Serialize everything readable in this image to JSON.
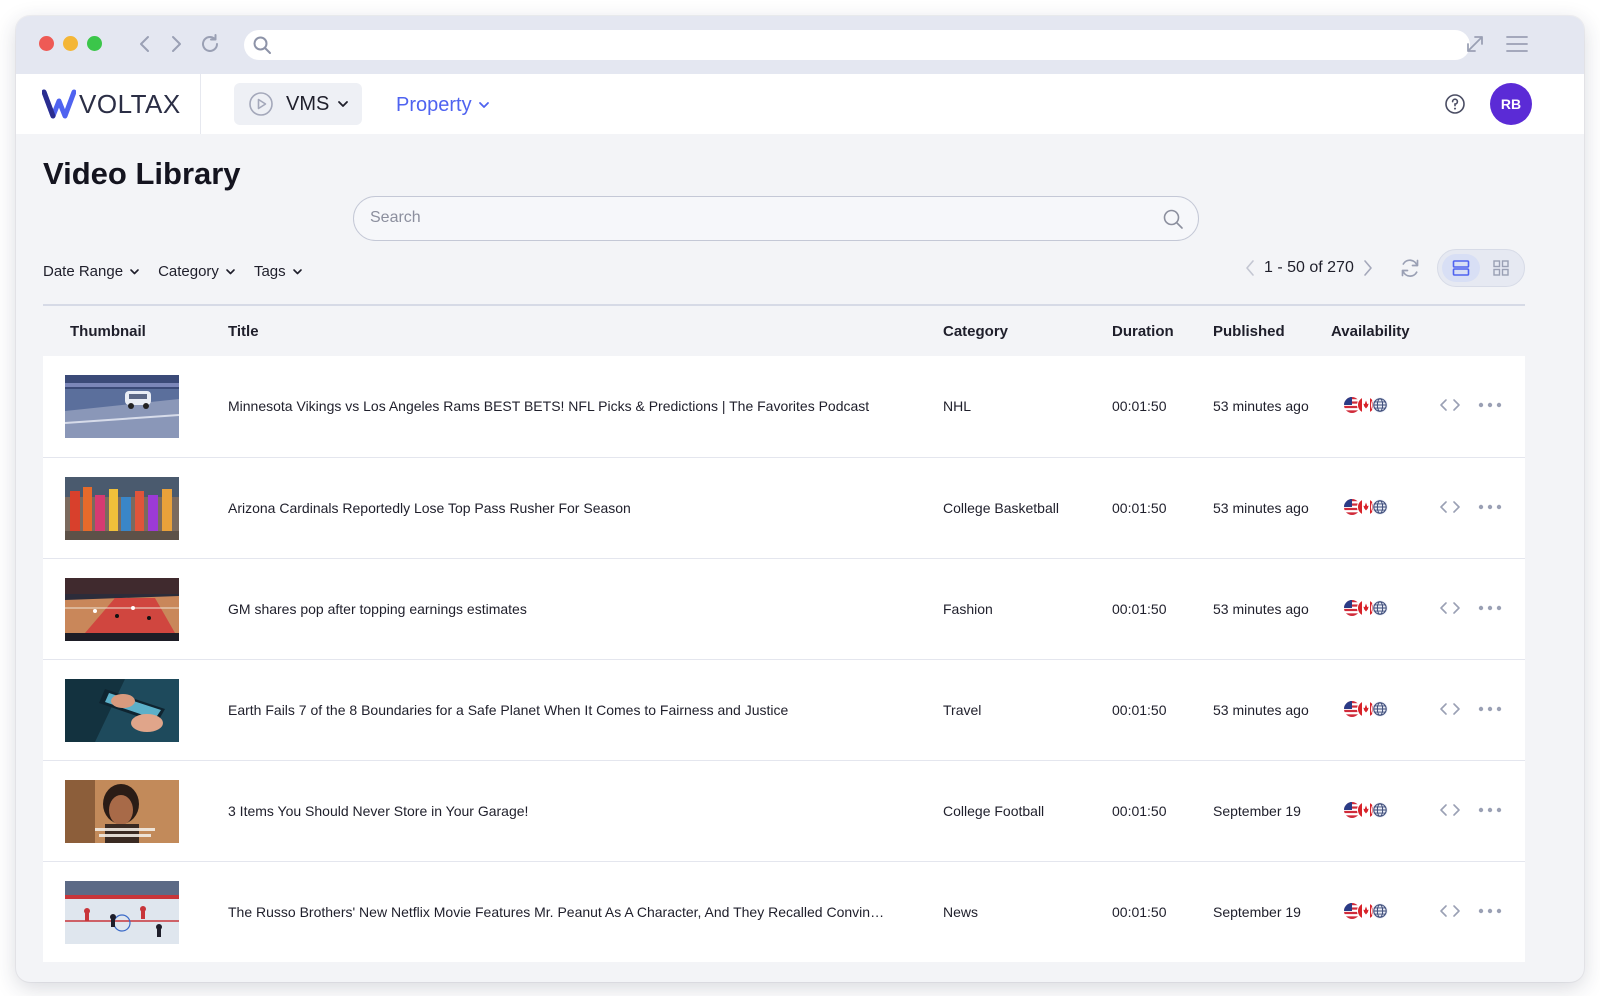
{
  "browser": {
    "url": ""
  },
  "header": {
    "logo_text": "VOLTAX",
    "product_label": "VMS",
    "property_label": "Property",
    "avatar_initials": "RB",
    "brand_color": "#4f63f0",
    "avatar_color": "#5b2bd6"
  },
  "page": {
    "title": "Video Library"
  },
  "search": {
    "placeholder": "Search",
    "value": ""
  },
  "filters": [
    {
      "label": "Date Range"
    },
    {
      "label": "Category"
    },
    {
      "label": "Tags"
    }
  ],
  "pagination": {
    "text": "1 - 50 of 270"
  },
  "view": {
    "selected": "list"
  },
  "table": {
    "columns": {
      "thumbnail": "Thumbnail",
      "title": "Title",
      "category": "Category",
      "duration": "Duration",
      "published": "Published",
      "availability": "Availability"
    },
    "rows": [
      {
        "thumbnail": "road-car",
        "title": "Minnesota Vikings vs Los Angeles Rams BEST BETS! NFL Picks & Predictions | The Favorites Podcast",
        "category": "NHL",
        "duration": "00:01:50",
        "published": "53 minutes ago"
      },
      {
        "thumbnail": "crowd-parade",
        "title": "Arizona Cardinals Reportedly Lose Top Pass Rusher For Season",
        "category": "College Basketball",
        "duration": "00:01:50",
        "published": "53 minutes ago"
      },
      {
        "thumbnail": "basketball-court",
        "title": "GM shares pop after topping earnings estimates",
        "category": "Fashion",
        "duration": "00:01:50",
        "published": "53 minutes ago"
      },
      {
        "thumbnail": "hands-phone",
        "title": "Earth Fails 7 of the 8 Boundaries for a Safe Planet When It Comes to Fairness and Justice",
        "category": "Travel",
        "duration": "00:01:50",
        "published": "53 minutes ago"
      },
      {
        "thumbnail": "woman-portrait",
        "title": "3 Items You Should Never Store in Your Garage!",
        "category": "College Football",
        "duration": "00:01:50",
        "published": "September 19"
      },
      {
        "thumbnail": "hockey-rink",
        "title": "The Russo Brothers' New Netflix Movie Features Mr. Peanut As A Character, And They Recalled Convinc...",
        "category": "News",
        "duration": "00:01:50",
        "published": "September 19"
      }
    ]
  },
  "availability_icons": [
    "us-flag-icon",
    "canada-flag-icon",
    "globe-icon"
  ]
}
